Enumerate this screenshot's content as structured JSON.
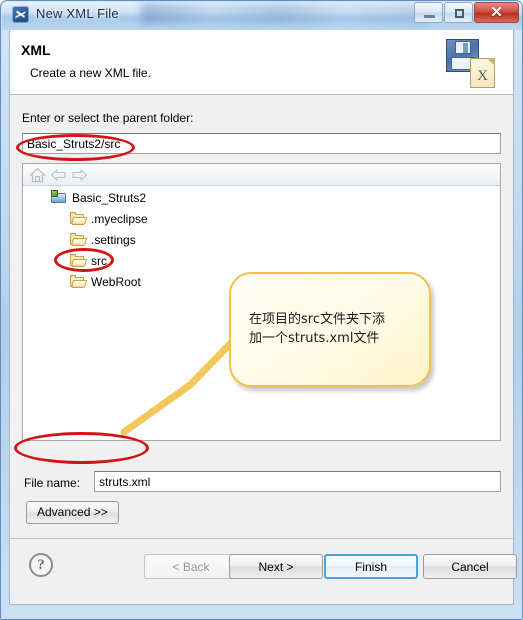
{
  "window": {
    "title": "New XML File",
    "app_icon": "myeclipse-icon",
    "buttons": {
      "minimize": "minimize-button",
      "maximize": "maximize-button",
      "close": "✕"
    }
  },
  "header": {
    "title": "XML",
    "subtitle": "Create a new XML file.",
    "icon": "xml-file-save-icon"
  },
  "form": {
    "parent_folder_label": "Enter or select the parent folder:",
    "parent_folder_value": "Basic_Struts2/src",
    "parent_folder_placeholder": "",
    "file_name_label": "File name:",
    "file_name_value": "struts.xml",
    "file_name_placeholder": "",
    "advanced_label": "Advanced >>"
  },
  "tree": {
    "toolbar": [
      {
        "name": "home-icon",
        "label": "Home"
      },
      {
        "name": "back-arrow-icon",
        "label": "Back"
      },
      {
        "name": "forward-arrow-icon",
        "label": "Forward"
      }
    ],
    "items": [
      {
        "label": "Basic_Struts2",
        "icon": "project-folder-icon",
        "indent": 0
      },
      {
        "label": ".myeclipse",
        "icon": "folder-icon",
        "indent": 1
      },
      {
        "label": ".settings",
        "icon": "folder-icon",
        "indent": 1
      },
      {
        "label": "src",
        "icon": "folder-icon",
        "indent": 1
      },
      {
        "label": "WebRoot",
        "icon": "folder-icon",
        "indent": 1
      }
    ]
  },
  "footer": {
    "help": "?",
    "back": "< Back",
    "next": "Next >",
    "finish": "Finish",
    "cancel": "Cancel"
  },
  "annotations": {
    "callout_text": "在项目的src文件夹下添\n加一个struts.xml文件",
    "highlight_color": "#d11414",
    "callout_border_color": "#f0c24a",
    "callout_fill_color": "#fffbe8",
    "ellipses": [
      {
        "name": "parent-folder-highlight"
      },
      {
        "name": "src-folder-highlight"
      },
      {
        "name": "file-name-highlight"
      }
    ]
  }
}
